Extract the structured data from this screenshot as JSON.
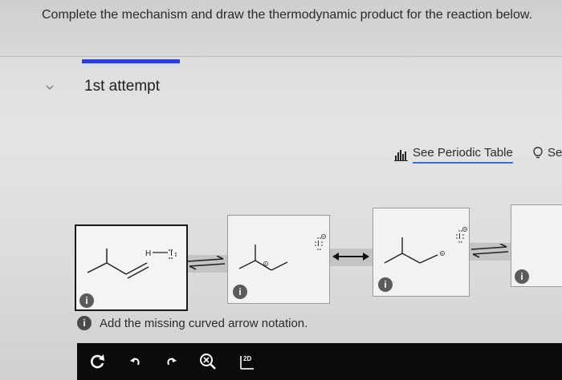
{
  "header": {
    "question": "Complete the mechanism and draw the thermodynamic product for the reaction below."
  },
  "attempt": {
    "title": "1st attempt"
  },
  "links": {
    "periodic_table": "See Periodic Table",
    "hint": "Se"
  },
  "panels": {
    "reactant": {
      "reagent": "H—I:",
      "h_label": "H",
      "i_label": "I"
    },
    "intermediate1": {
      "iodide": "I"
    },
    "intermediate2": {
      "iodide": "I"
    }
  },
  "info_icon_letter": "i",
  "message": {
    "text": "Add the missing curved arrow notation."
  },
  "toolbar": {
    "tools": [
      "reset-icon",
      "undo-icon",
      "redo-icon",
      "zoom-icon",
      "2d-template-icon"
    ],
    "template_label": "2D"
  },
  "colors": {
    "accent": "#2d3fd6",
    "link_underline": "#3a6ed8",
    "toolbar_bg": "#0b0b0b",
    "info_icon": "#5b5b5b"
  }
}
